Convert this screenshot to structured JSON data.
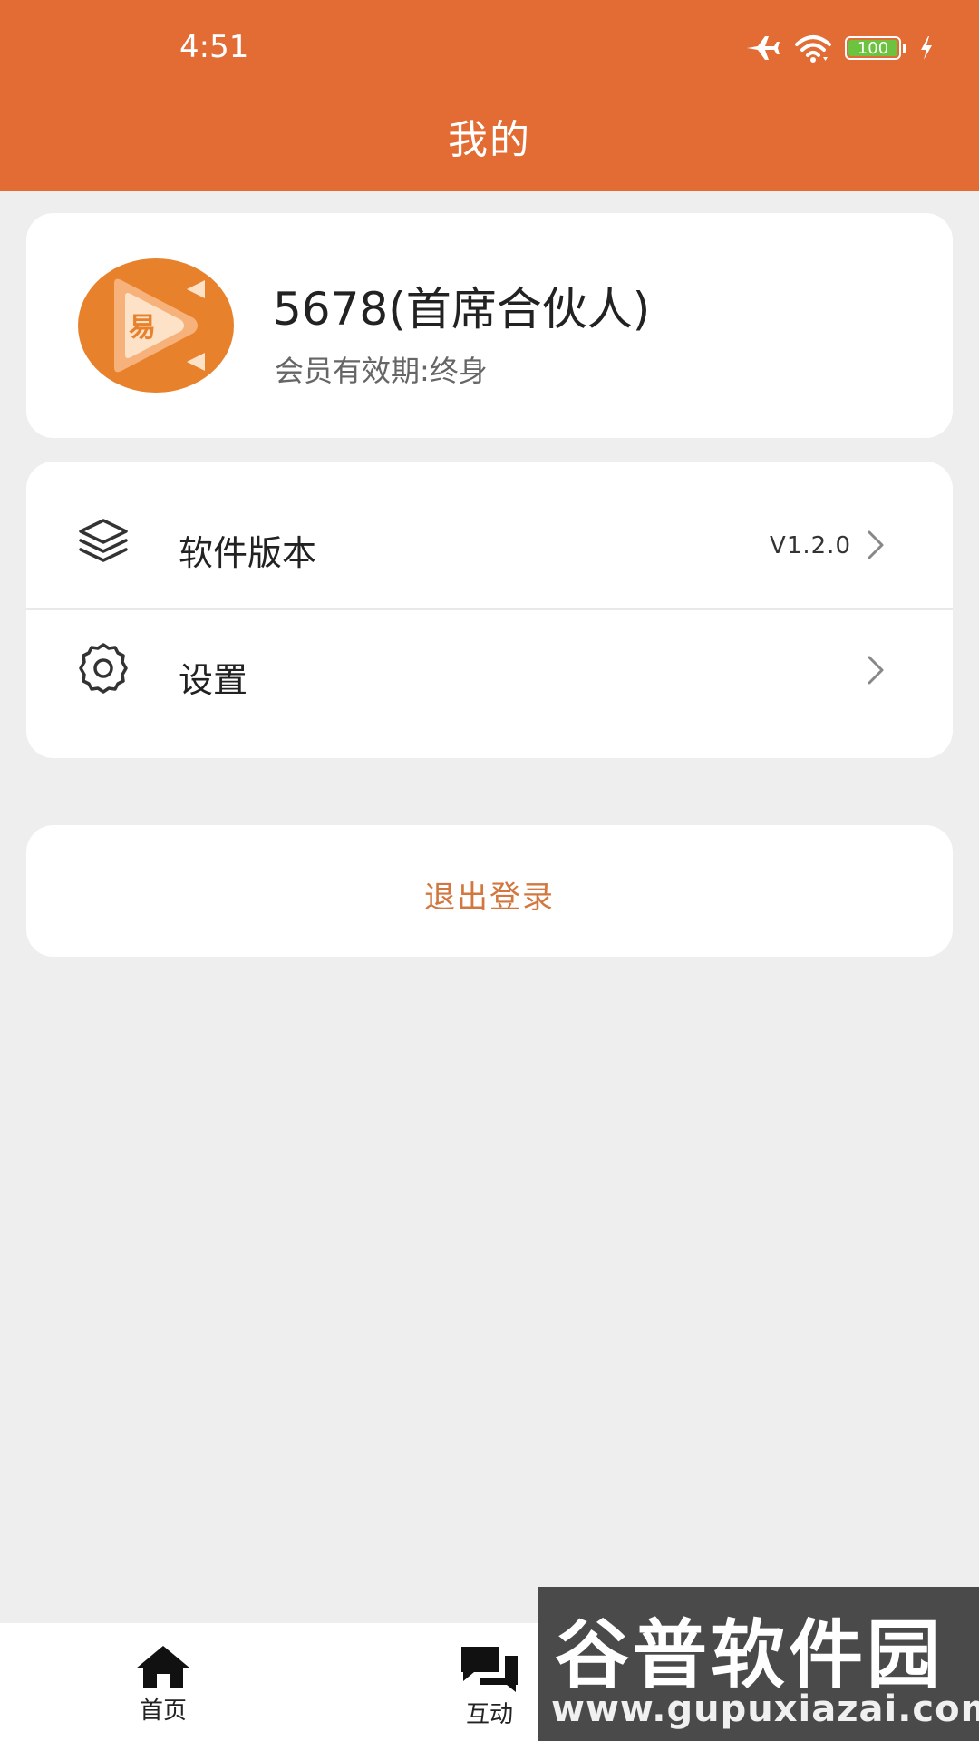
{
  "status_bar": {
    "time": "4:51",
    "battery": "100",
    "icons": [
      "airplane-icon",
      "wifi-icon",
      "battery-icon",
      "charging-icon"
    ]
  },
  "header": {
    "title": "我的",
    "color": "#e36b34"
  },
  "profile": {
    "avatar_text": "易",
    "name": "5678(首席合伙人)",
    "membership": "会员有效期:终身"
  },
  "menu": {
    "items": [
      {
        "label": "软件版本",
        "value": "V1.2.0",
        "icon": "layers-icon"
      },
      {
        "label": "设置",
        "value": "",
        "icon": "gear-icon"
      }
    ]
  },
  "logout": {
    "label": "退出登录",
    "color": "#d2773f"
  },
  "bottom_nav": {
    "items": [
      {
        "label": "首页",
        "icon": "home-icon"
      },
      {
        "label": "互动",
        "icon": "chat-icon"
      }
    ]
  },
  "watermark": {
    "line1": "谷普软件园",
    "line2": "www.gupuxiazai.com"
  }
}
